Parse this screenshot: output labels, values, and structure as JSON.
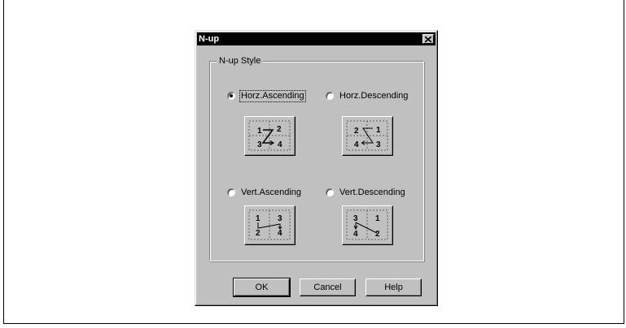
{
  "dialog": {
    "title": "N-up",
    "close_icon": "close-icon"
  },
  "group": {
    "label": "N-up Style"
  },
  "options": [
    {
      "label": "Horz.Ascending",
      "selected": true,
      "pages": [
        "1",
        "2",
        "3",
        "4"
      ]
    },
    {
      "label": "Horz.Descending",
      "selected": false,
      "pages": [
        "2",
        "1",
        "4",
        "3"
      ]
    },
    {
      "label": "Vert.Ascending",
      "selected": false,
      "pages": [
        "1",
        "3",
        "2",
        "4"
      ]
    },
    {
      "label": "Vert.Descending",
      "selected": false,
      "pages": [
        "3",
        "1",
        "4",
        "2"
      ]
    }
  ],
  "buttons": {
    "ok": "OK",
    "cancel": "Cancel",
    "help": "Help"
  },
  "colors": {
    "face": "#c0c0c0",
    "titlebar": "#000000"
  }
}
